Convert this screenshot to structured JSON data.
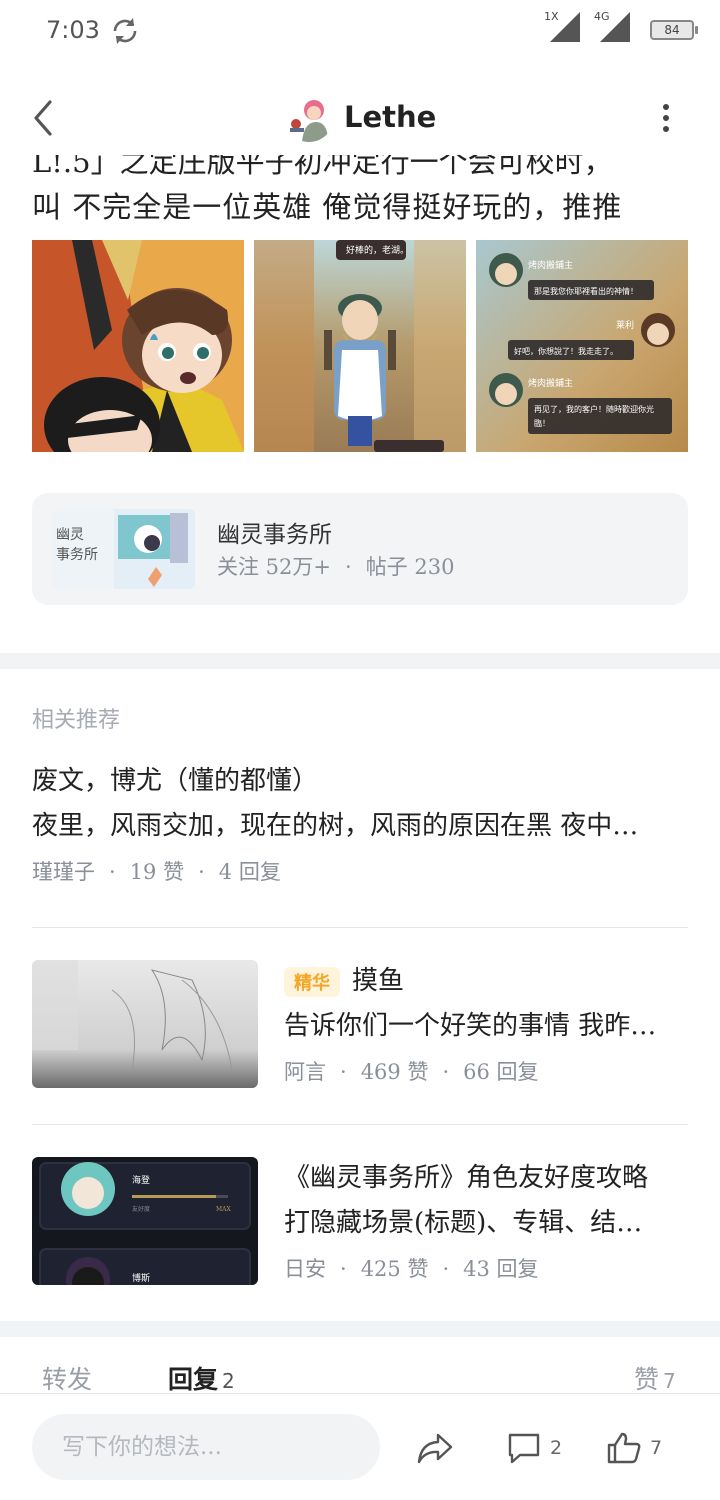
{
  "status_bar": {
    "time": "7:03",
    "signal1_label": "1X",
    "signal2_label": "4G",
    "battery": "84"
  },
  "header": {
    "title": "Lethe"
  },
  "post": {
    "clipped_line": "L!.5」之定庄版平子初冲定行一个会可校时，",
    "text_line": "叫 不完全是一位英雄 俺觉得挺好玩的，推推"
  },
  "forum": {
    "name": "幽灵事务所",
    "followers": "关注 52万+",
    "posts": "帖子 230",
    "separator": "·",
    "thumb_text": "幽灵事务所"
  },
  "related": {
    "heading": "相关推荐",
    "items": [
      {
        "title": "废文，博尤（懂的都懂）",
        "body": "夜里，风雨交加，现在的树，风雨的原因在黑 夜中…",
        "author": "瑾瑾子",
        "likes": "19 赞",
        "replies": "4 回复"
      },
      {
        "badge": "精华",
        "title": "摸鱼",
        "body": "告诉你们一个好笑的事情 我昨…",
        "author": "阿言",
        "likes": "469 赞",
        "replies": "66 回复"
      },
      {
        "title": "《幽灵事务所》角色友好度攻略",
        "body": "打隐藏场景(标题)、专辑、结…",
        "author": "日安",
        "likes": "425 赞",
        "replies": "43 回复",
        "thumb": {
          "name1": "海登",
          "label": "友好度",
          "max": "MAX",
          "name2": "博斯"
        }
      }
    ]
  },
  "tabs": {
    "forward": "转发",
    "reply": "回复",
    "reply_count": "2",
    "like": "赞",
    "like_count": "7"
  },
  "bottom_bar": {
    "placeholder": "写下你的想法...",
    "comment_count": "2",
    "like_count": "7"
  },
  "comic": {
    "panel2_bubble_top": "好棒的，老湖。",
    "panel3_name1": "烤肉搬鋪主",
    "panel3_msg1": "那是我您你耶裡看出的神情！",
    "panel3_name2": "莱利",
    "panel3_msg2": "好吧，你想說了！我走走了。",
    "panel3_name3": "烤肉搬鋪主",
    "panel3_msg3": "再见了，我的客户！随時歡迎你光臨！"
  }
}
